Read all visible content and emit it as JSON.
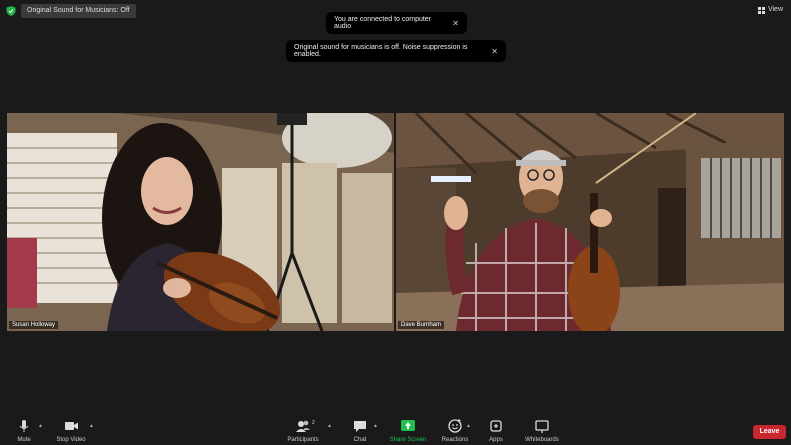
{
  "top_bar": {
    "audio_badge": "Original Sound for Musicians: Off",
    "view_label": "View"
  },
  "toasts": [
    {
      "text": "You are connected to computer audio",
      "close": "✕"
    },
    {
      "text": "Original sound for musicians is off. Noise suppression is enabled.",
      "close": "✕"
    }
  ],
  "participants": [
    {
      "name": "Susan Holloway"
    },
    {
      "name": "Dave Burnham"
    }
  ],
  "toolbar": {
    "mute": "Mute",
    "stop_video": "Stop Video",
    "participants": "Participants",
    "participants_count": "2",
    "chat": "Chat",
    "share_screen": "Share Screen",
    "reactions": "Reactions",
    "apps": "Apps",
    "whiteboards": "Whiteboards",
    "leave": "Leave"
  },
  "colors": {
    "share_green": "#1fbf4d",
    "leave_red": "#c8272d",
    "shield_green": "#21b24a"
  },
  "icons": [
    "shield-icon",
    "view-grid-icon",
    "close-icon",
    "microphone-icon",
    "camera-icon",
    "participants-icon",
    "chat-icon",
    "share-screen-icon",
    "reactions-icon",
    "apps-icon",
    "whiteboard-icon",
    "chevron-up-icon"
  ]
}
